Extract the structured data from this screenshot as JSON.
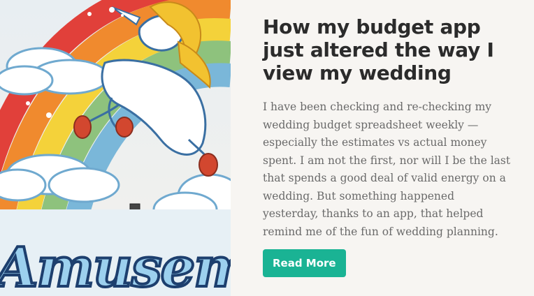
{
  "post": {
    "title": "How my budget app just altered the way I view my wedding",
    "excerpt": "I have been checking and re-checking my wedding budget spreadsheet weekly — especially the estimates vs actual money spent. I am not the first, nor will I be the last that spends a good deal of valid energy on a wedding. But something happened yesterday, thanks to an app, that helped remind me of the fun of wedding planning.",
    "read_more_label": "Read More"
  },
  "image": {
    "sign_text": "Amuseme"
  },
  "colors": {
    "accent": "#1ab394",
    "title": "#2b2b2b",
    "body_text": "#6a6a6a",
    "background": "#f7f5f2"
  }
}
